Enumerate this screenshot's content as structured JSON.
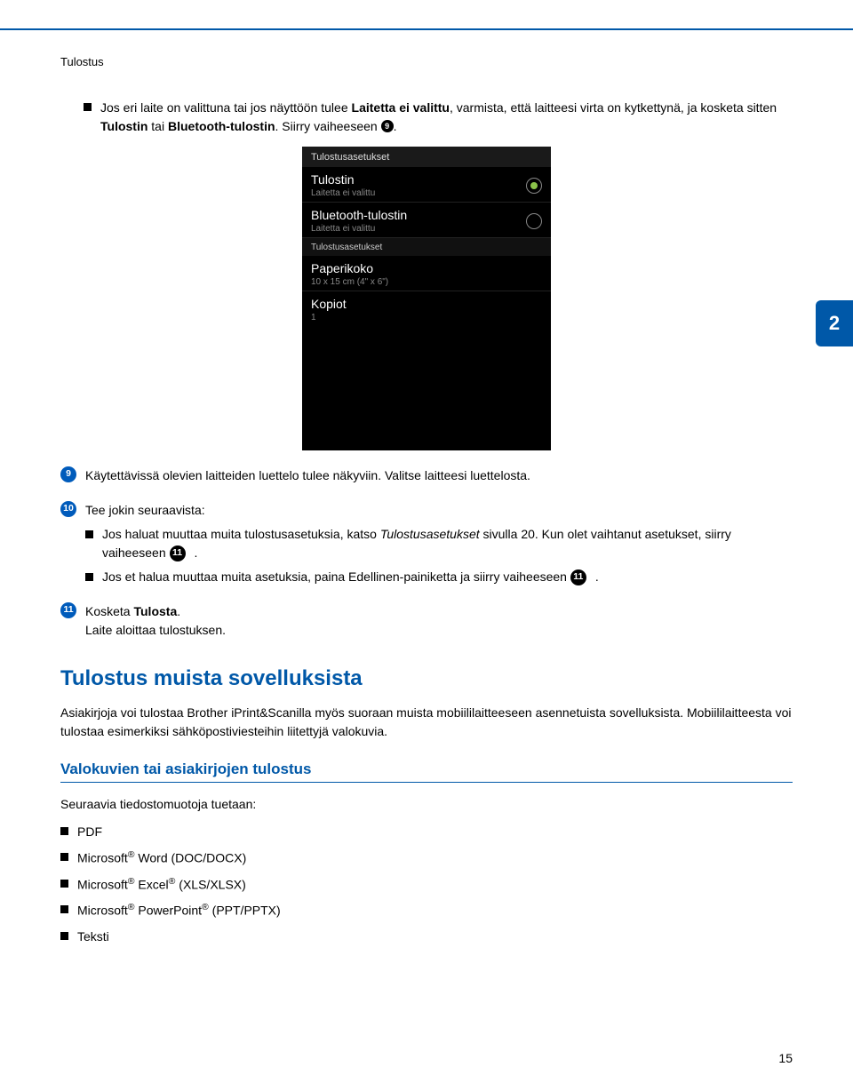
{
  "section_label": "Tulostus",
  "side_tab": "2",
  "intro": {
    "before_bold": "Jos eri laite on valittuna tai jos näyttöön tulee ",
    "bold1": "Laitetta ei valittu",
    "mid": ", varmista, että laitteesi virta on kytkettynä, ja kosketa sitten ",
    "bold2": "Tulostin",
    "mid2": " tai ",
    "bold3": "Bluetooth-tulostin",
    "after": ". Siirry vaiheeseen ",
    "ref_num": "9",
    "end": "."
  },
  "screenshot": {
    "title": "Tulostusasetukset",
    "rows": [
      {
        "main": "Tulostin",
        "sub": "Laitetta ei valittu",
        "radio": true,
        "selected": true
      },
      {
        "main": "Bluetooth-tulostin",
        "sub": "Laitetta ei valittu",
        "radio": true,
        "selected": false
      }
    ],
    "section2": "Tulostusasetukset",
    "rows2": [
      {
        "main": "Paperikoko",
        "sub": "10 x 15 cm (4\" x 6\")"
      },
      {
        "main": "Kopiot",
        "sub": "1"
      }
    ]
  },
  "steps": {
    "s9": {
      "num": "9",
      "text": "Käytettävissä olevien laitteiden luettelo tulee näkyviin. Valitse laitteesi luettelosta."
    },
    "s10": {
      "num": "10",
      "lead": "Tee jokin seuraavista:",
      "b1_a": "Jos haluat muuttaa muita tulostusasetuksia, katso ",
      "b1_i": "Tulostusasetukset",
      "b1_b": " sivulla 20. Kun olet vaihtanut asetukset, siirry vaiheeseen ",
      "b1_ref": "11",
      "b1_end": ".",
      "b2_a": "Jos et halua muuttaa muita asetuksia, paina Edellinen-painiketta ja siirry vaiheeseen ",
      "b2_ref": "11",
      "b2_end": "."
    },
    "s11": {
      "num": "11",
      "a": "Kosketa ",
      "bold": "Tulosta",
      "b": ".",
      "line2": "Laite aloittaa tulostuksen."
    }
  },
  "h2": "Tulostus muista sovelluksista",
  "p_after_h2": "Asiakirjoja voi tulostaa Brother iPrint&Scanilla myös suoraan muista mobiililaitteeseen asennetuista sovelluksista. Mobiililaitteesta voi tulostaa esimerkiksi sähköpostiviesteihin liitettyjä valokuvia.",
  "h3": "Valokuvien tai asiakirjojen tulostus",
  "p_after_h3": "Seuraavia tiedostomuotoja tuetaan:",
  "filetypes": {
    "pdf": "PDF",
    "word_pre": "Microsoft",
    "word_post": " Word (DOC/DOCX)",
    "excel_pre": "Microsoft",
    "excel_mid": " Excel",
    "excel_post": " (XLS/XLSX)",
    "ppt_pre": "Microsoft",
    "ppt_mid": " PowerPoint",
    "ppt_post": " (PPT/PPTX)",
    "txt": "Teksti"
  },
  "page_num": "15"
}
